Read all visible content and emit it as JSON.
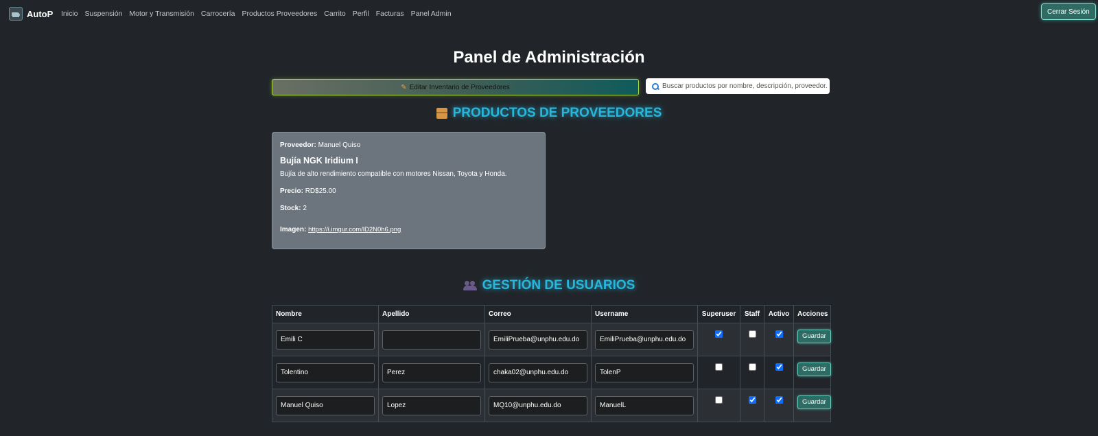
{
  "navbar": {
    "brand": "AutoP",
    "links": [
      "Inicio",
      "Suspensión",
      "Motor y Transmisión",
      "Carrocería",
      "Productos Proveedores",
      "Carrito",
      "Perfil",
      "Facturas",
      "Panel Admin"
    ],
    "logout_label": "Cerrar Sesión"
  },
  "page_title": "Panel de Administración",
  "edit_inventory_label": "Editar Inventario de Proveedores",
  "search": {
    "placeholder": "Buscar productos por nombre, descripción, proveedor..."
  },
  "products_section": {
    "title": "PRODUCTOS DE PROVEEDORES",
    "card": {
      "supplier_label": "Proveedor:",
      "supplier": "Manuel Quiso",
      "name": "Bujía NGK Iridium I",
      "description": "Bujía de alto rendimiento compatible con motores Nissan, Toyota y Honda.",
      "price_label": "Precio:",
      "price": "RD$25.00",
      "stock_label": "Stock:",
      "stock": "2",
      "image_label": "Imagen:",
      "image_url": "https://i.imgur.com/lD2N0h6.png"
    }
  },
  "users_section": {
    "title": "GESTIÓN DE USUARIOS",
    "columns": [
      "Nombre",
      "Apellido",
      "Correo",
      "Username",
      "Superuser",
      "Staff",
      "Activo",
      "Acciones"
    ],
    "save_label": "Guardar",
    "rows": [
      {
        "nombre": "Emili C",
        "apellido": "",
        "correo": "EmiliPrueba@unphu.edu.do",
        "username": "EmiliPrueba@unphu.edu.do",
        "superuser": true,
        "staff": false,
        "activo": true
      },
      {
        "nombre": "Tolentino",
        "apellido": "Perez",
        "correo": "chaka02@unphu.edu.do",
        "username": "TolenP",
        "superuser": false,
        "staff": false,
        "activo": true
      },
      {
        "nombre": "Manuel Quiso",
        "apellido": "Lopez",
        "correo": "MQ10@unphu.edu.do",
        "username": "ManuelL",
        "superuser": false,
        "staff": true,
        "activo": true
      }
    ]
  },
  "icons": {
    "products": "package-icon",
    "users": "users-icon",
    "edit": "pencil-icon",
    "search": "search-icon"
  },
  "colors": {
    "background": "#212529",
    "accent_cyan": "#28b6dc",
    "card": "#6c757d",
    "button_teal": "#2f6a63"
  }
}
